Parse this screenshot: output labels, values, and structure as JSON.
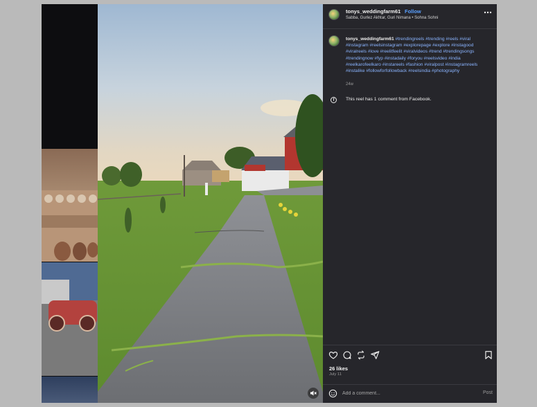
{
  "post": {
    "username": "tonys_weddingfarm61",
    "follow_label": "Follow",
    "separator": "•",
    "subline": "Sabba, Gurlez Akhtar, Guri Nimana • Sohna Sohni",
    "more_icon": "more-horizontal-icon",
    "caption": {
      "username": "tonys_weddingfarm61",
      "hashtags": "#trendingreels #trending #reels #viral #instagram #reelsinstagram #explorepage #explore #instagood #viralreels #love #reelitfeelit #viralvideos #trend #trendingsongs #trendingnow #fyp #instadaily #foryou #reelsvideo #india #reelkarofeelkaro #instareels #fashion #viralpost #instagramreels #instalike #followforfollowback #reelsindia #photography",
      "age": "24w"
    },
    "facebook_note": {
      "icon": "facebook-icon",
      "text": "This reel has 1 comment from Facebook."
    },
    "likes": "26 likes",
    "date": "July 11",
    "comment": {
      "placeholder": "Add a comment...",
      "post_label": "Post"
    },
    "actions": {
      "like_icon": "heart-icon",
      "comment_icon": "comment-icon",
      "share_icon": "repost-icon",
      "send_icon": "send-icon",
      "save_icon": "bookmark-icon"
    }
  },
  "video": {
    "mute_icon": "speaker-muted-icon"
  },
  "colors": {
    "panel_bg": "#26262b",
    "accent": "#5aa0ff",
    "hashtag": "#8ab4ff"
  }
}
